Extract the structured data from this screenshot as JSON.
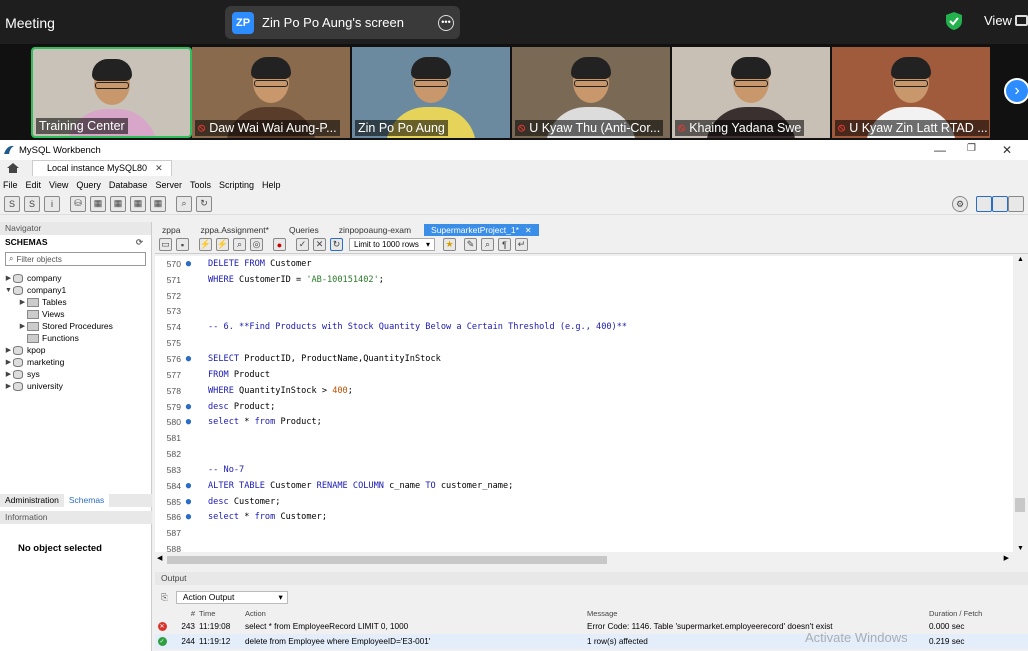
{
  "zoom": {
    "meeting_label": "Meeting",
    "share_title": "Zin Po Po Aung's screen",
    "share_initials": "ZP",
    "view_label": "View",
    "participants": [
      {
        "name": "Training Center",
        "muted": false,
        "active": true,
        "bg": "#c9c2b8",
        "shirt": "#d7a6c8"
      },
      {
        "name": "Daw Wai Wai Aung-P...",
        "muted": true,
        "active": false,
        "bg": "#8a6a4c",
        "shirt": "#5a3c2a"
      },
      {
        "name": "Zin Po Po Aung",
        "muted": false,
        "active": false,
        "bg": "#6b8aa0",
        "shirt": "#e6d45a"
      },
      {
        "name": "U Kyaw Thu (Anti-Cor...",
        "muted": true,
        "active": false,
        "bg": "#7a6a55",
        "shirt": "#dcdcdc"
      },
      {
        "name": "Khaing Yadana Swe",
        "muted": true,
        "active": false,
        "bg": "#c8c0b5",
        "shirt": "#3a3030"
      },
      {
        "name": "U Kyaw Zin Latt RTAD ...",
        "muted": true,
        "active": false,
        "bg": "#a05a3c",
        "shirt": "#f2f2f2"
      }
    ]
  },
  "workbench": {
    "title": "MySQL Workbench",
    "connection_tab": "Local instance MySQL80",
    "menu": [
      "File",
      "Edit",
      "View",
      "Query",
      "Database",
      "Server",
      "Tools",
      "Scripting",
      "Help"
    ],
    "navigator": {
      "header": "Navigator",
      "schemas_label": "SCHEMAS",
      "filter_placeholder": "Filter objects",
      "tree": [
        {
          "label": "company",
          "level": 0,
          "kind": "db",
          "arrow": "▶"
        },
        {
          "label": "company1",
          "level": 0,
          "kind": "db",
          "arrow": "▼"
        },
        {
          "label": "Tables",
          "level": 1,
          "kind": "folder",
          "arrow": "▶"
        },
        {
          "label": "Views",
          "level": 1,
          "kind": "folder",
          "arrow": ""
        },
        {
          "label": "Stored Procedures",
          "level": 1,
          "kind": "folder",
          "arrow": "▶"
        },
        {
          "label": "Functions",
          "level": 1,
          "kind": "folder",
          "arrow": ""
        },
        {
          "label": "kpop",
          "level": 0,
          "kind": "db",
          "arrow": "▶"
        },
        {
          "label": "marketing",
          "level": 0,
          "kind": "db",
          "arrow": "▶"
        },
        {
          "label": "sys",
          "level": 0,
          "kind": "db",
          "arrow": "▶"
        },
        {
          "label": "university",
          "level": 0,
          "kind": "db",
          "arrow": "▶"
        }
      ],
      "tab_admin": "Administration",
      "tab_schemas": "Schemas",
      "info_header": "Information",
      "no_object": "No object selected"
    },
    "query_tabs": [
      "zppa",
      "zppa.Assignment*",
      "Queries",
      "zinpopoaung-exam",
      "SupermarketProject_1*"
    ],
    "limit_rows": "Limit to 1000 rows",
    "code_lines": [
      {
        "n": "570",
        "dot": true,
        "html": "<span class='kw'>DELETE FROM</span> Customer"
      },
      {
        "n": "571",
        "dot": false,
        "html": "<span class='kw'>WHERE</span> CustomerID = <span class='st'>'AB-100151402'</span>;"
      },
      {
        "n": "572",
        "dot": false,
        "html": ""
      },
      {
        "n": "573",
        "dot": false,
        "html": ""
      },
      {
        "n": "574",
        "dot": false,
        "html": "<span class='cm'>-- 6. **Find Products with Stock Quantity Below a Certain Threshold (e.g., 400)**</span>"
      },
      {
        "n": "575",
        "dot": false,
        "html": ""
      },
      {
        "n": "576",
        "dot": true,
        "html": "<span class='kw'>SELECT</span> ProductID, ProductName,QuantityInStock"
      },
      {
        "n": "577",
        "dot": false,
        "html": "<span class='kw'>FROM</span> Product"
      },
      {
        "n": "578",
        "dot": false,
        "html": "<span class='kw'>WHERE</span> QuantityInStock &gt; <span class='nm2'>400</span>;"
      },
      {
        "n": "579",
        "dot": true,
        "html": "<span class='kw'>desc</span> Product;"
      },
      {
        "n": "580",
        "dot": true,
        "html": "<span class='kw'>select</span> * <span class='kw'>from</span> Product;"
      },
      {
        "n": "581",
        "dot": false,
        "html": ""
      },
      {
        "n": "582",
        "dot": false,
        "html": ""
      },
      {
        "n": "583",
        "dot": false,
        "html": "<span class='cm'>-- No-7</span>"
      },
      {
        "n": "584",
        "dot": true,
        "html": "<span class='kw'>ALTER TABLE</span> Customer <span class='kw'>RENAME COLUMN</span> c_name <span class='kw'>TO</span> customer_name;"
      },
      {
        "n": "585",
        "dot": true,
        "html": "<span class='kw'>desc</span> Customer;"
      },
      {
        "n": "586",
        "dot": true,
        "html": "<span class='kw'>select</span> * <span class='kw'>from</span> Customer;"
      },
      {
        "n": "587",
        "dot": false,
        "html": ""
      },
      {
        "n": "588",
        "dot": false,
        "html": ""
      }
    ],
    "output": {
      "header": "Output",
      "selector": "Action Output",
      "columns": {
        "num": "#",
        "time": "Time",
        "action": "Action",
        "message": "Message",
        "duration": "Duration / Fetch"
      },
      "rows": [
        {
          "status": "error",
          "num": "243",
          "time": "11:19:08",
          "action": "select * from EmployeeRecord LIMIT 0, 1000",
          "message": "Error Code: 1146. Table 'supermarket.employeerecord' doesn't exist",
          "duration": "0.000 sec"
        },
        {
          "status": "ok",
          "num": "244",
          "time": "11:19:12",
          "action": "delete from Employee where EmployeeID='E3-001'",
          "message": "1 row(s) affected",
          "duration": "0.219 sec"
        }
      ]
    },
    "watermark": "Activate Windows"
  }
}
